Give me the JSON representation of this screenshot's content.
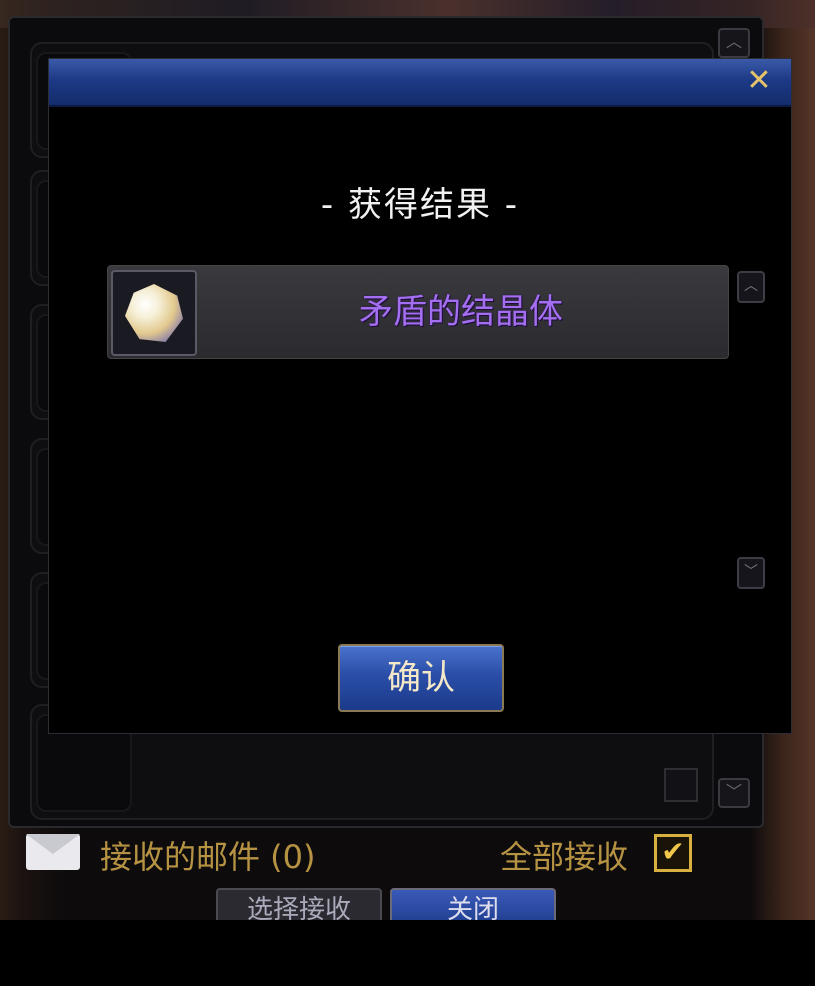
{
  "dialog": {
    "title": "- 获得结果 -",
    "close_icon": "close-icon",
    "items": [
      {
        "name": "矛盾的结晶体",
        "icon": "crystal-icon",
        "name_color": "#a46ef0"
      }
    ],
    "confirm_label": "确认",
    "scroll_up_symbol": "︿",
    "scroll_down_symbol": "﹀"
  },
  "mailbox": {
    "received_label": "接收的邮件 (0)",
    "accept_all_label": "全部接收",
    "accept_all_checked": "✔",
    "select_receive_label": "选择接收",
    "close_label": "关闭",
    "scroll_up_symbol": "︿",
    "scroll_down_symbol": "﹀"
  },
  "colors": {
    "titlebar": "#1d3a86",
    "gold": "#d8b040",
    "item_purple": "#a46ef0"
  }
}
